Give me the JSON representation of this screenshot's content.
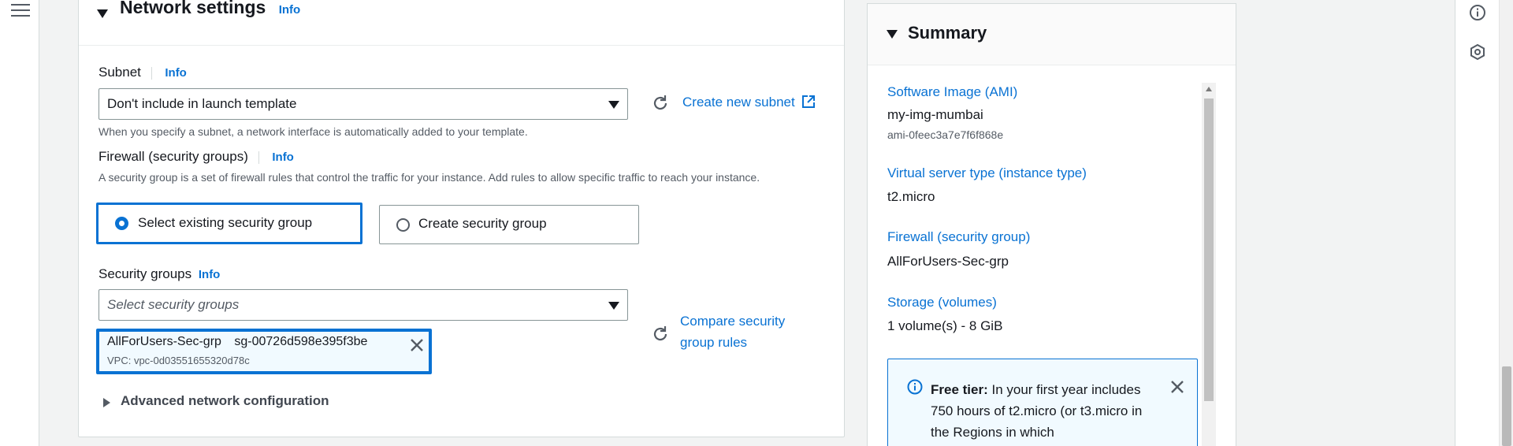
{
  "colors": {
    "accent": "#0972d3",
    "text": "#16191f",
    "muted": "#545b64",
    "page_bg": "#f2f3f3"
  },
  "network": {
    "title": "Network settings",
    "info": "Info",
    "subnet": {
      "label": "Subnet",
      "info": "Info",
      "value": "Don't include in launch template",
      "help": "When you specify a subnet, a network interface is automatically added to your template.",
      "create_link": "Create new subnet"
    },
    "firewall": {
      "label": "Firewall (security groups)",
      "info": "Info",
      "help": "A security group is a set of firewall rules that control the traffic for your instance. Add rules to allow specific traffic to reach your instance.",
      "option_existing": "Select existing security group",
      "option_create": "Create security group",
      "selected": "existing"
    },
    "security_groups": {
      "label": "Security groups",
      "info": "Info",
      "placeholder": "Select security groups",
      "compare_link_line1": "Compare security",
      "compare_link_line2": "group rules",
      "token": {
        "name": "AllForUsers-Sec-grp",
        "id": "sg-00726d598e395f3be",
        "vpc": "VPC: vpc-0d03551655320d78c"
      }
    },
    "advanced": "Advanced network configuration"
  },
  "summary": {
    "title": "Summary",
    "ami_label": "Software Image (AMI)",
    "ami_name": "my-img-mumbai",
    "ami_id": "ami-0feec3a7e7f6f868e",
    "instance_label": "Virtual server type (instance type)",
    "instance_value": "t2.micro",
    "firewall_label": "Firewall (security group)",
    "firewall_value": "AllForUsers-Sec-grp",
    "storage_label": "Storage (volumes)",
    "storage_value": "1 volume(s) - 8 GiB",
    "free_tier_bold": "Free tier:",
    "free_tier_text": "In your first year includes 750 hours of t2.micro (or t3.micro in the Regions in which"
  },
  "icons": {
    "menu": "hamburger-menu-icon",
    "info": "info-circle-icon",
    "settings": "hexagon-settings-icon",
    "refresh": "refresh-icon",
    "external": "external-link-icon",
    "close": "close-icon"
  }
}
